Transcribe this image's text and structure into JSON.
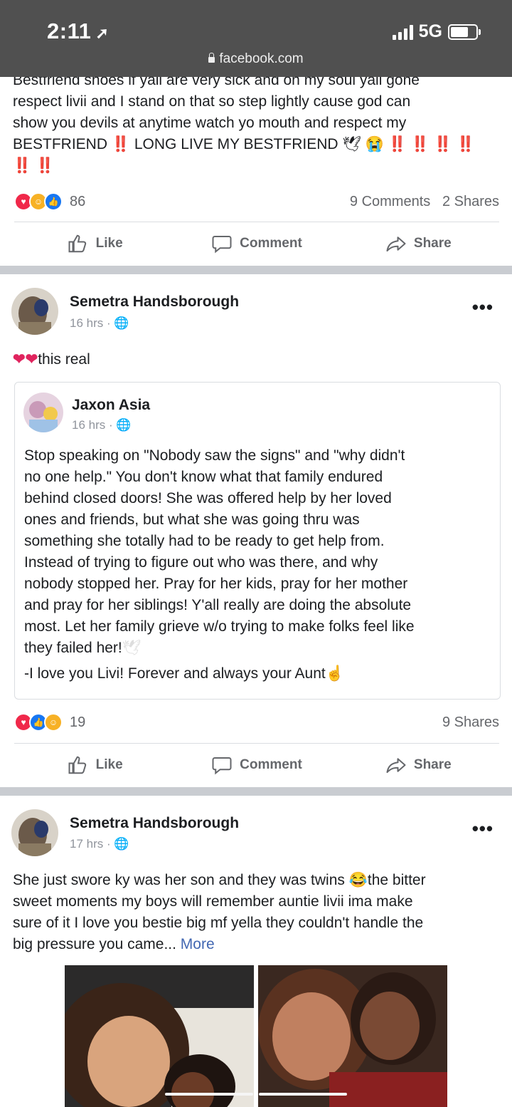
{
  "status_bar": {
    "time": "2:11",
    "network": "5G",
    "url": "facebook.com"
  },
  "post1": {
    "text_line1": "Bestfriend shoes if yall are very sick and on my soul yall gone",
    "text_line2": "respect livii and I stand on that so step lightly cause god can",
    "text_line3": "show you devils at anytime watch yo mouth and respect my",
    "text_line4": "BESTFRIEND",
    "text_line4b": "LONG LIVE MY BESTFRIEND",
    "bang": "‼️",
    "reaction_count": "86",
    "comments": "9 Comments",
    "shares": "2 Shares"
  },
  "actions": {
    "like": "Like",
    "comment": "Comment",
    "share": "Share"
  },
  "post2": {
    "author": "Semetra Handsborough",
    "time": "16 hrs",
    "text": "this real",
    "shared": {
      "author": "Jaxon Asia",
      "time": "16 hrs",
      "body": [
        "Stop speaking on \"Nobody saw the signs\" and \"why didn't",
        "no one help.\" You don't know what that family endured",
        "behind closed doors! She was offered help by her loved",
        "ones and friends, but what she was going thru was",
        "something she totally had to be ready to get help from.",
        "Instead of trying to figure out who was there, and why",
        "nobody stopped her. Pray for her kids, pray for her mother",
        "and pray for her siblings! Y'all really are doing the absolute",
        "most. Let her family grieve w/o trying to make folks feel like",
        "they failed her!"
      ],
      "signoff": "-I love you Livi! Forever and always your Aunt"
    },
    "reaction_count": "19",
    "shares": "9 Shares"
  },
  "post3": {
    "author": "Semetra Handsborough",
    "time": "17 hrs",
    "line1a": "She just swore ky was her son and they was twins",
    "line1b": "the bitter",
    "line2": "sweet moments my boys will remember auntie livii ima make",
    "line3": "sure of it I love you bestie big mf yella they couldn't handle the",
    "line4": "big pressure you came...",
    "more": "More"
  },
  "colors": {
    "status_bar": "#505050",
    "link": "#4267b2",
    "divider": "#c9ccd1"
  }
}
